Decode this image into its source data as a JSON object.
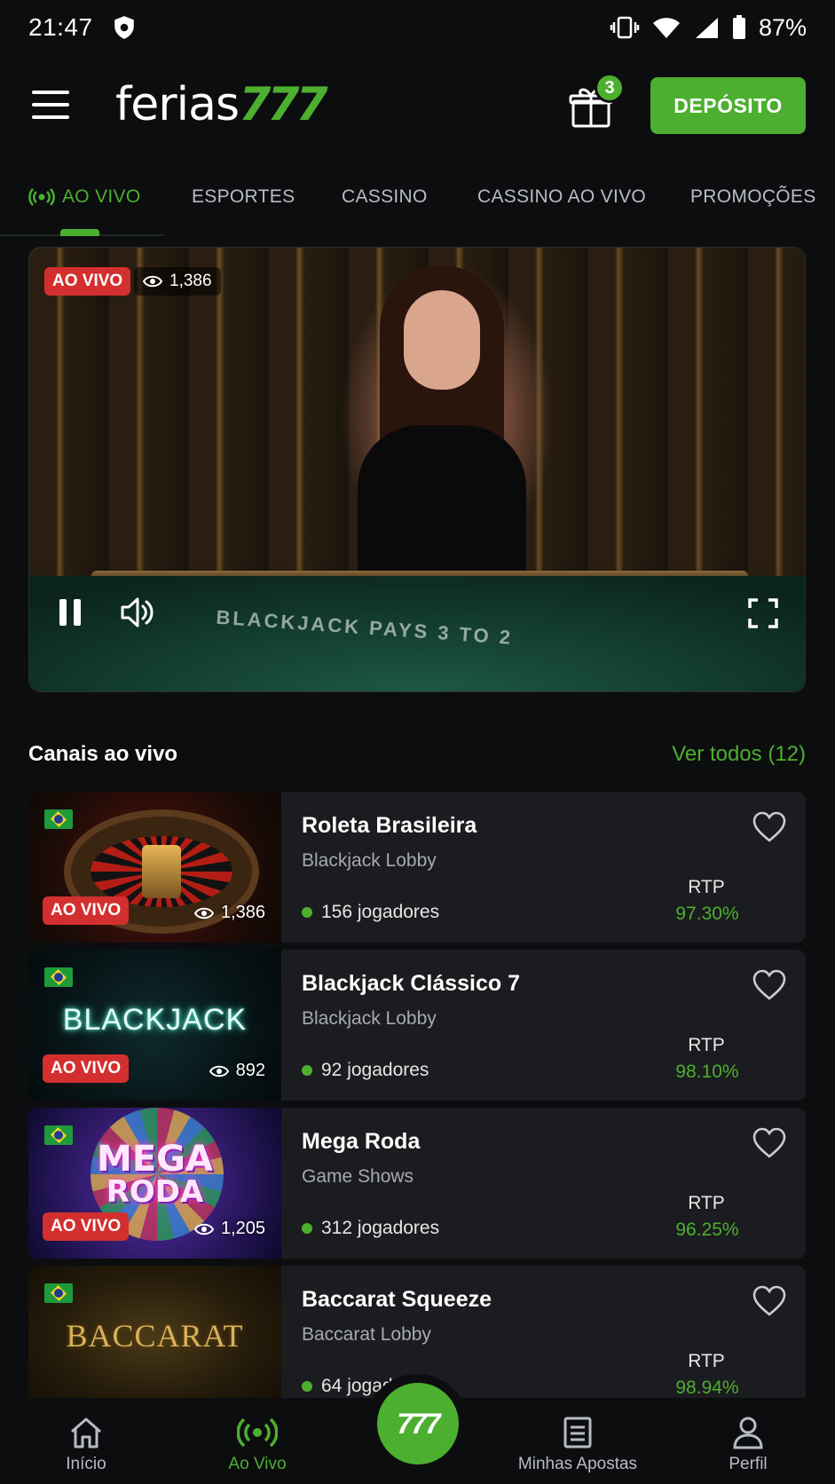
{
  "status_bar": {
    "time": "21:47",
    "battery": "87%"
  },
  "header": {
    "logo_text": "ferias",
    "logo_num": "777",
    "gift_count": "3",
    "deposit_label": "DEPÓSITO"
  },
  "tabs": [
    {
      "label": "AO VIVO",
      "active": true
    },
    {
      "label": "ESPORTES"
    },
    {
      "label": "CASSINO"
    },
    {
      "label": "CASSINO AO VIVO"
    },
    {
      "label": "PROMOÇÕES"
    }
  ],
  "player": {
    "live_label": "AO VIVO",
    "viewers": "1,386",
    "felt_text": "BLACKJACK PAYS 3 TO 2"
  },
  "section": {
    "title": "Canais ao vivo",
    "see_all": "Ver todos (12)"
  },
  "channels": [
    {
      "name": "Roleta Brasileira",
      "category": "Blackjack Lobby",
      "players": "156 jogadores",
      "rtp_label": "RTP",
      "rtp": "97.30%",
      "live": "AO VIVO",
      "viewers": "1,386"
    },
    {
      "name": "Blackjack Clássico 7",
      "category": "Blackjack Lobby",
      "players": "92 jogadores",
      "rtp_label": "RTP",
      "rtp": "98.10%",
      "live": "AO VIVO",
      "viewers": "892",
      "thumb_text": "BLACKJACK"
    },
    {
      "name": "Mega Roda",
      "category": "Game Shows",
      "players": "312 jogadores",
      "rtp_label": "RTP",
      "rtp": "96.25%",
      "live": "AO VIVO",
      "viewers": "1,205",
      "thumb_text1": "MEGA",
      "thumb_text2": "RODA"
    },
    {
      "name": "Baccarat Squeeze",
      "category": "Baccarat Lobby",
      "players": "64 jogadores",
      "rtp_label": "RTP",
      "rtp": "98.94%",
      "thumb_text": "BACCARAT"
    }
  ],
  "bottom_nav": [
    {
      "label": "Início",
      "icon": "home-icon"
    },
    {
      "label": "Ao Vivo",
      "icon": "live-icon",
      "active": true
    },
    {
      "label": "777",
      "icon": "brand-center"
    },
    {
      "label": "Minhas Apostas",
      "icon": "bets-icon"
    },
    {
      "label": "Perfil",
      "icon": "user-icon"
    }
  ],
  "colors": {
    "accent": "#4caf2f",
    "live": "#d32f2f",
    "background": "#0c0d0f",
    "card": "#1b1c1f"
  }
}
